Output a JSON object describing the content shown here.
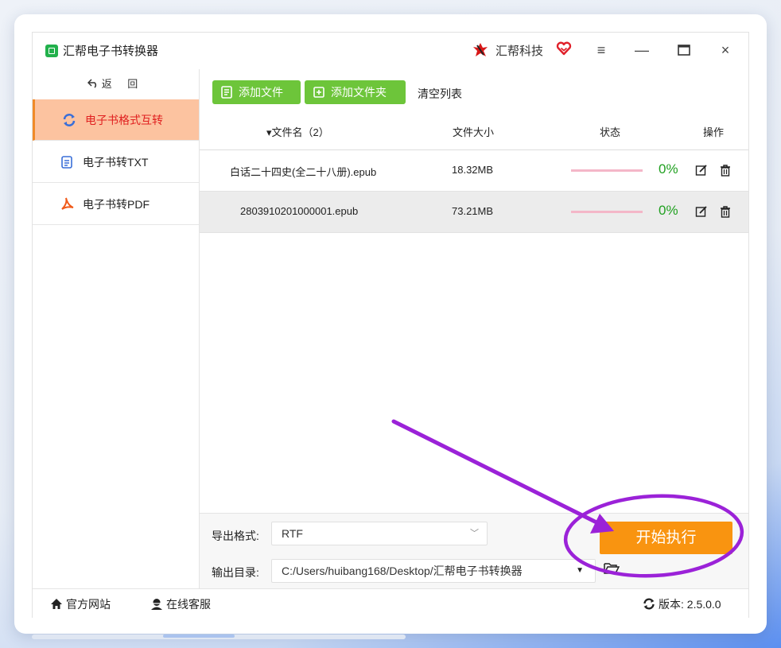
{
  "app": {
    "title": "汇帮电子书转换器",
    "brand": "汇帮科技",
    "window_controls": {
      "menu": "≡",
      "minimize": "—",
      "maximize": "□",
      "close": "×"
    }
  },
  "sidebar": {
    "back_label": "返 回",
    "items": [
      {
        "label": "电子书格式互转",
        "icon": "refresh-icon",
        "active": true
      },
      {
        "label": "电子书转TXT",
        "icon": "txt-file-icon",
        "active": false
      },
      {
        "label": "电子书转PDF",
        "icon": "pdf-icon",
        "active": false
      }
    ]
  },
  "toolbar": {
    "add_file": "添加文件",
    "add_folder": "添加文件夹",
    "clear_list": "清空列表"
  },
  "table": {
    "headers": {
      "name": "▾文件名（2）",
      "size": "文件大小",
      "status": "状态",
      "actions": "操作"
    },
    "rows": [
      {
        "name": "白话二十四史(全二十八册).epub",
        "size": "18.32MB",
        "progress": "0%"
      },
      {
        "name": "2803910201000001.epub",
        "size": "73.21MB",
        "progress": "0%"
      }
    ]
  },
  "settings": {
    "format_label": "导出格式:",
    "format_value": "RTF",
    "dir_label": "输出目录:",
    "dir_value": "C:/Users/huibang168/Desktop/汇帮电子书转换器",
    "start_button": "开始执行"
  },
  "footer": {
    "website": "官方网站",
    "support": "在线客服",
    "version": "版本: 2.5.0.0"
  },
  "colors": {
    "accent_green": "#6dc53a",
    "accent_orange": "#f99410",
    "active_bg": "#fcc3a0",
    "annotation_purple": "#9b22d8"
  }
}
